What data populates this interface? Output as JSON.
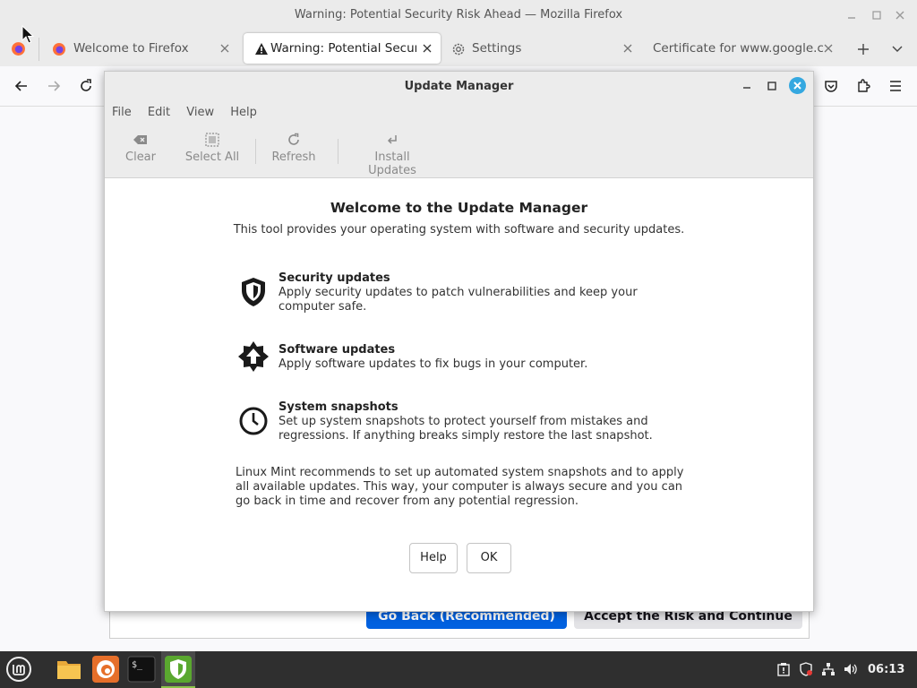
{
  "firefox": {
    "window_title": "Warning: Potential Security Risk Ahead — Mozilla Firefox",
    "tabs": [
      {
        "label": "Welcome to Firefox",
        "icon": "firefox-icon"
      },
      {
        "label": "Warning: Potential Security Risk Ahead",
        "icon": "warning-icon",
        "active": true
      },
      {
        "label": "Settings",
        "icon": "gear-icon"
      },
      {
        "label": "Certificate for www.google.com",
        "icon": "none"
      }
    ],
    "page": {
      "go_back_label": "Go Back (Recommended)",
      "accept_label": "Accept the Risk and Continue"
    }
  },
  "update_manager": {
    "title": "Update Manager",
    "menu": [
      "File",
      "Edit",
      "View",
      "Help"
    ],
    "toolbar": {
      "clear": "Clear",
      "select_all": "Select All",
      "refresh": "Refresh",
      "install_updates": "Install Updates"
    },
    "heading": "Welcome to the Update Manager",
    "subheading": "This tool provides your operating system with software and security updates.",
    "features": [
      {
        "title": "Security updates",
        "desc": "Apply security updates to patch vulnerabilities and keep your computer safe.",
        "icon": "shield-icon"
      },
      {
        "title": "Software updates",
        "desc": "Apply software updates to fix bugs in your computer.",
        "icon": "star-arrow-icon"
      },
      {
        "title": "System snapshots",
        "desc": "Set up system snapshots to protect yourself from mistakes and regressions. If anything breaks simply restore the last snapshot.",
        "icon": "clock-icon"
      }
    ],
    "recommendation": "Linux Mint recommends to set up automated system snapshots and to apply all available updates. This way, your computer is always secure and you can go back in time and recover from any potential regression.",
    "buttons": {
      "help": "Help",
      "ok": "OK"
    }
  },
  "taskbar": {
    "clock": "06:13",
    "apps": [
      "menu-icon",
      "files-icon",
      "firefox-icon",
      "terminal-icon",
      "update-manager-icon"
    ]
  },
  "colors": {
    "accent_blue": "#0061e0",
    "close_blue": "#35a8e0",
    "mint_green": "#5aa82f"
  }
}
